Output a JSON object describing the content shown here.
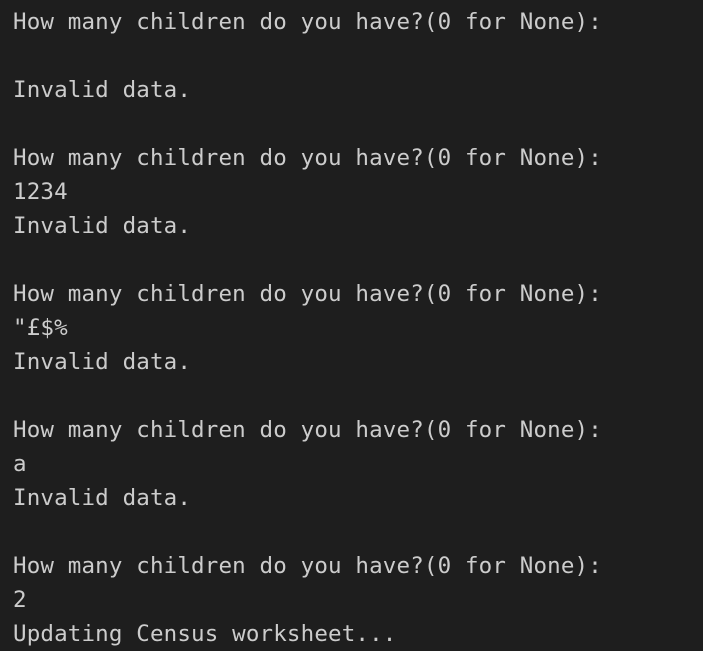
{
  "terminal": {
    "lines": [
      "How many children do you have?(0 for None):",
      "",
      "Invalid data.",
      "",
      "How many children do you have?(0 for None):",
      "1234",
      "Invalid data.",
      "",
      "How many children do you have?(0 for None):",
      "\"£$%",
      "Invalid data.",
      "",
      "How many children do you have?(0 for None):",
      "a",
      "Invalid data.",
      "",
      "How many children do you have?(0 for None):",
      "2",
      "Updating Census worksheet..."
    ],
    "colors": {
      "background": "#1e1e1e",
      "text": "#cccccc"
    }
  }
}
